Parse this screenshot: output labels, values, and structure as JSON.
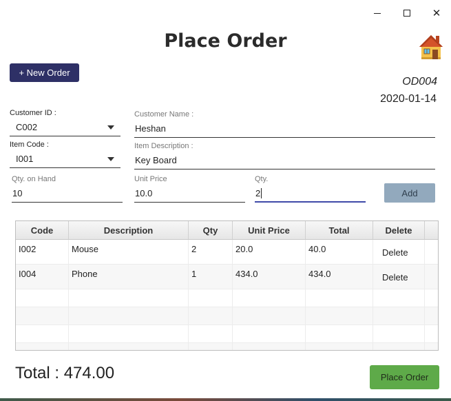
{
  "window": {
    "minimize_label": "–",
    "close_label": "✕"
  },
  "header": {
    "title": "Place Order",
    "home_icon": "house-icon"
  },
  "actions": {
    "new_order_label": "+ New Order",
    "add_label": "Add",
    "place_order_label": "Place Order"
  },
  "order": {
    "id": "OD004",
    "date": "2020-01-14"
  },
  "form": {
    "customer_id": {
      "label": "Customer ID :",
      "value": "C002"
    },
    "customer_name": {
      "label": "Customer Name :",
      "value": "Heshan"
    },
    "item_code": {
      "label": "Item Code :",
      "value": "I001"
    },
    "item_description": {
      "label": "Item Description :",
      "value": "Key Board"
    },
    "qty_on_hand": {
      "label": "Qty. on Hand",
      "value": "10"
    },
    "unit_price": {
      "label": "Unit Price",
      "value": "10.0"
    },
    "qty": {
      "label": "Qty.",
      "value": "2"
    }
  },
  "table": {
    "columns": [
      "Code",
      "Description",
      "Qty",
      "Unit Price",
      "Total",
      "Delete"
    ],
    "rows": [
      {
        "code": "I002",
        "description": "Mouse",
        "qty": "2",
        "unit_price": "20.0",
        "total": "40.0",
        "delete": "Delete"
      },
      {
        "code": "I004",
        "description": "Phone",
        "qty": "1",
        "unit_price": "434.0",
        "total": "434.0",
        "delete": "Delete"
      }
    ]
  },
  "summary": {
    "total_text": "Total : 474.00"
  },
  "colors": {
    "primary": "#2e3066",
    "add_button": "#92a9bd",
    "place_order_button": "#5eaa49",
    "focus_underline": "#3e49a8"
  }
}
